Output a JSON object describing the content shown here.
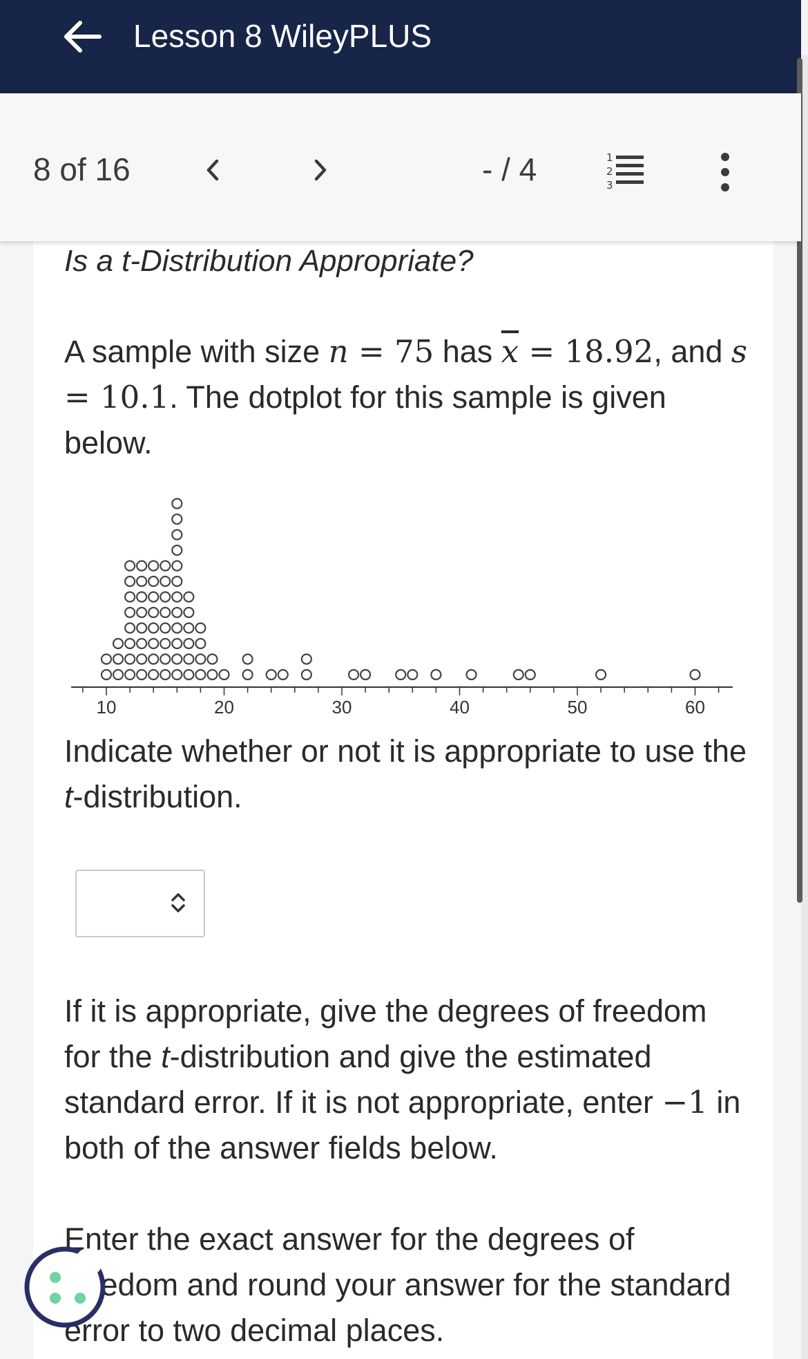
{
  "header": {
    "title": "Lesson 8 WileyPLUS"
  },
  "nav": {
    "page_counter": "8 of 16",
    "score": "- / 4",
    "list_icon_label": "123"
  },
  "question": {
    "title": "Is a t-Distribution Appropriate?",
    "intro": {
      "p1": "A sample with size ",
      "n_var": "n",
      "eq1": " = 75",
      "has": " has ",
      "xbar_var": "x",
      "eq2": " = 18.92",
      "and": ", and",
      "s_var": "s",
      "eq3": " = 10.1",
      "rest": ". The dotplot for this sample is given below."
    },
    "indicate": {
      "p1": "Indicate whether or not it is appropriate to use the ",
      "t": "t",
      "p2": "-distribution."
    },
    "select_value": "",
    "if_appropriate": {
      "p1": "If it is appropriate, give the degrees of freedom for the ",
      "t": "t",
      "p2": "-distribution and give the estimated standard error. If it is not appropriate, enter ",
      "neg_one": "−1",
      "p3": " in both of the answer fields below."
    },
    "enter_exact": "Enter the exact answer for the degrees of freedom and round your answer for the standard error to two decimal places."
  },
  "chart_data": {
    "type": "dotplot",
    "x_axis_ticks": [
      10,
      20,
      30,
      40,
      50,
      60
    ],
    "xlim": [
      5,
      63
    ],
    "points": [
      {
        "x": 10,
        "count": 2
      },
      {
        "x": 11,
        "count": 3
      },
      {
        "x": 12,
        "count": 8
      },
      {
        "x": 13,
        "count": 8
      },
      {
        "x": 14,
        "count": 8
      },
      {
        "x": 15,
        "count": 8
      },
      {
        "x": 16,
        "count": 12
      },
      {
        "x": 17,
        "count": 6
      },
      {
        "x": 18,
        "count": 4
      },
      {
        "x": 19,
        "count": 2
      },
      {
        "x": 20,
        "count": 1
      },
      {
        "x": 22,
        "count": 2
      },
      {
        "x": 24,
        "count": 1
      },
      {
        "x": 25,
        "count": 1
      },
      {
        "x": 27,
        "count": 2
      },
      {
        "x": 31,
        "count": 1
      },
      {
        "x": 32,
        "count": 1
      },
      {
        "x": 35,
        "count": 1
      },
      {
        "x": 36,
        "count": 1
      },
      {
        "x": 38,
        "count": 1
      },
      {
        "x": 41,
        "count": 1
      },
      {
        "x": 45,
        "count": 1
      },
      {
        "x": 46,
        "count": 1
      },
      {
        "x": 52,
        "count": 1
      },
      {
        "x": 60,
        "count": 1
      }
    ]
  }
}
